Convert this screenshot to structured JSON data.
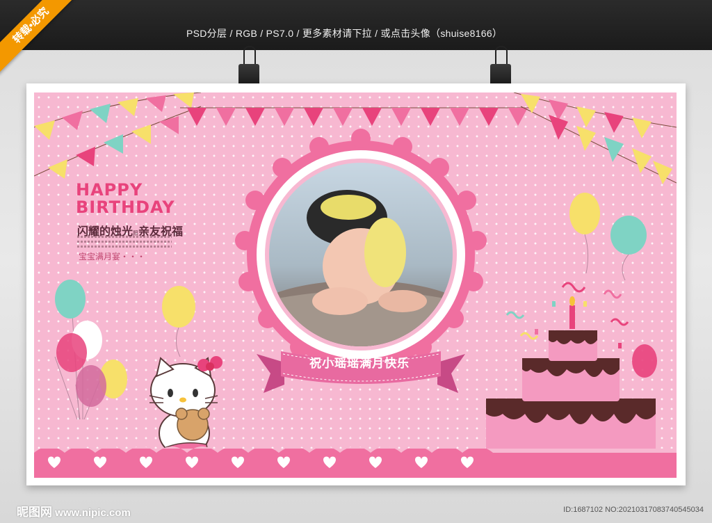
{
  "header": {
    "info_text": "PSD分层 / RGB / PS7.0 / 更多素材请下拉 / 或点击头像（shuise8166）",
    "corner_badge": "转载•必究"
  },
  "poster": {
    "title_line1": "HAPPY",
    "title_line2": "BIRTHDAY",
    "tagline_main": "闪耀的烛光",
    "tagline_small": "照",
    "tagline_rest": "亲友祝福",
    "subtitle": "宝宝满月宴・・・",
    "ribbon_text": "祝小瑶瑶满月快乐",
    "character": "hello-kitty-with-teddy-bear",
    "colors": {
      "background": "#f7b8d1",
      "accent": "#e8437c",
      "ribbon": "#f06fa0"
    }
  },
  "watermark": {
    "logo_text": "昵图网",
    "site": "www.nipic.com",
    "id_text": "ID:1687102 NO:20210317083740545034"
  }
}
